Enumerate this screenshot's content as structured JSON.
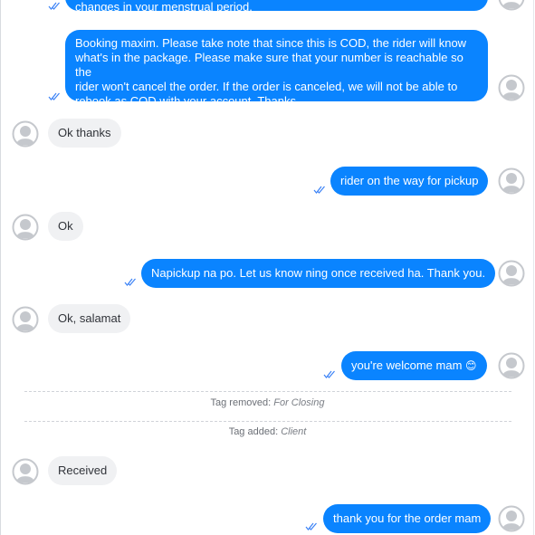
{
  "messages": {
    "m0": {
      "text": "changes in your menstrual period."
    },
    "m1": {
      "lines": [
        "Booking maxim. Please take note that since this is COD, the rider will know",
        "what's in the package. Please make sure that your number is reachable so the",
        "rider won't cancel the order. If the order is canceled, we will not be able to",
        "rebook as COD with your account. Thanks."
      ]
    },
    "m2": {
      "text": "Ok thanks"
    },
    "m3": {
      "text": "rider on the way for pickup"
    },
    "m4": {
      "text": "Ok"
    },
    "m5": {
      "text": "Napickup na po. Let us know ning once received ha. Thank you."
    },
    "m6": {
      "text": "Ok, salamat"
    },
    "m7": {
      "text": "you're welcome mam",
      "emoji": "😊"
    },
    "m8": {
      "text": "Received"
    },
    "m9": {
      "text": "thank you for the order mam"
    }
  },
  "events": {
    "tag_removed": {
      "label": "Tag removed:",
      "value": "For Closing"
    },
    "tag_added": {
      "label": "Tag added:",
      "value": "Client"
    }
  },
  "icons": {
    "avatar": "avatar-placeholder-icon",
    "read_receipt": "double-check-icon"
  },
  "colors": {
    "outgoing_bubble": "#0a84ff",
    "incoming_bubble": "#f0f1f3",
    "read_check": "#3b82f6"
  }
}
